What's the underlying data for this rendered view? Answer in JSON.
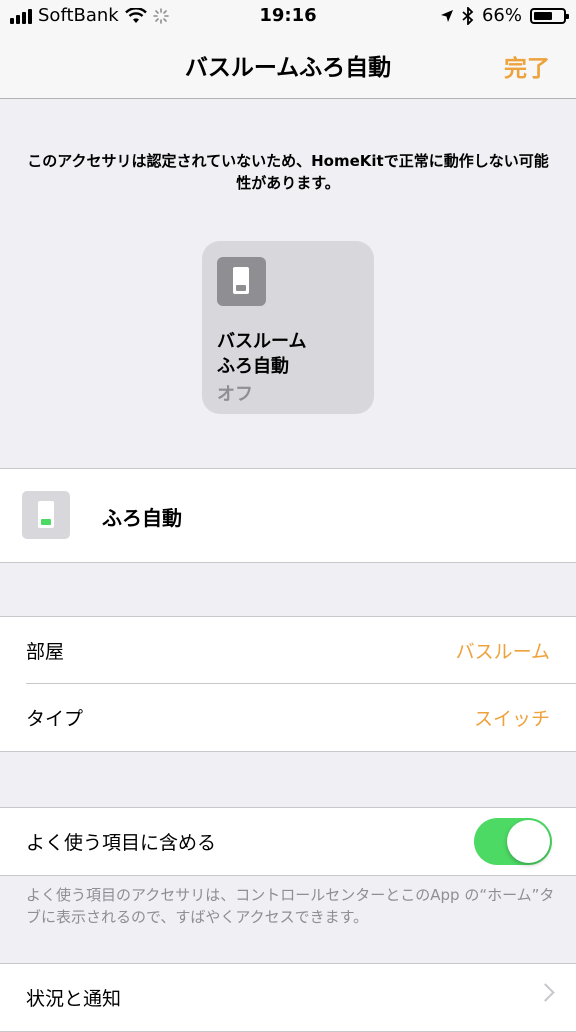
{
  "status_bar": {
    "carrier": "SoftBank",
    "time": "19:16",
    "battery": "66%",
    "battery_level": 0.66
  },
  "nav": {
    "title": "バスルームふろ自動",
    "done_label": "完了"
  },
  "warning": "このアクセサリは認定されていないため、HomeKitで正常に動作しない可能性があります。",
  "tile": {
    "name_line1": "バスルーム",
    "name_line2": "ふろ自動",
    "state": "オフ"
  },
  "service": {
    "name": "ふろ自動"
  },
  "details": {
    "room_label": "部屋",
    "room_value": "バスルーム",
    "type_label": "タイプ",
    "type_value": "スイッチ"
  },
  "favorites": {
    "label": "よく使う項目に含める",
    "enabled": true,
    "footnote": "よく使う項目のアクセサリは、コントロールセンターとこのApp の“ホーム”タブに表示されるので、すばやくアクセスできます。"
  },
  "status_notifications": {
    "label": "状況と通知"
  },
  "colors": {
    "accent": "#eea23c",
    "toggle_on": "#4cd964",
    "background": "#efeff4"
  }
}
